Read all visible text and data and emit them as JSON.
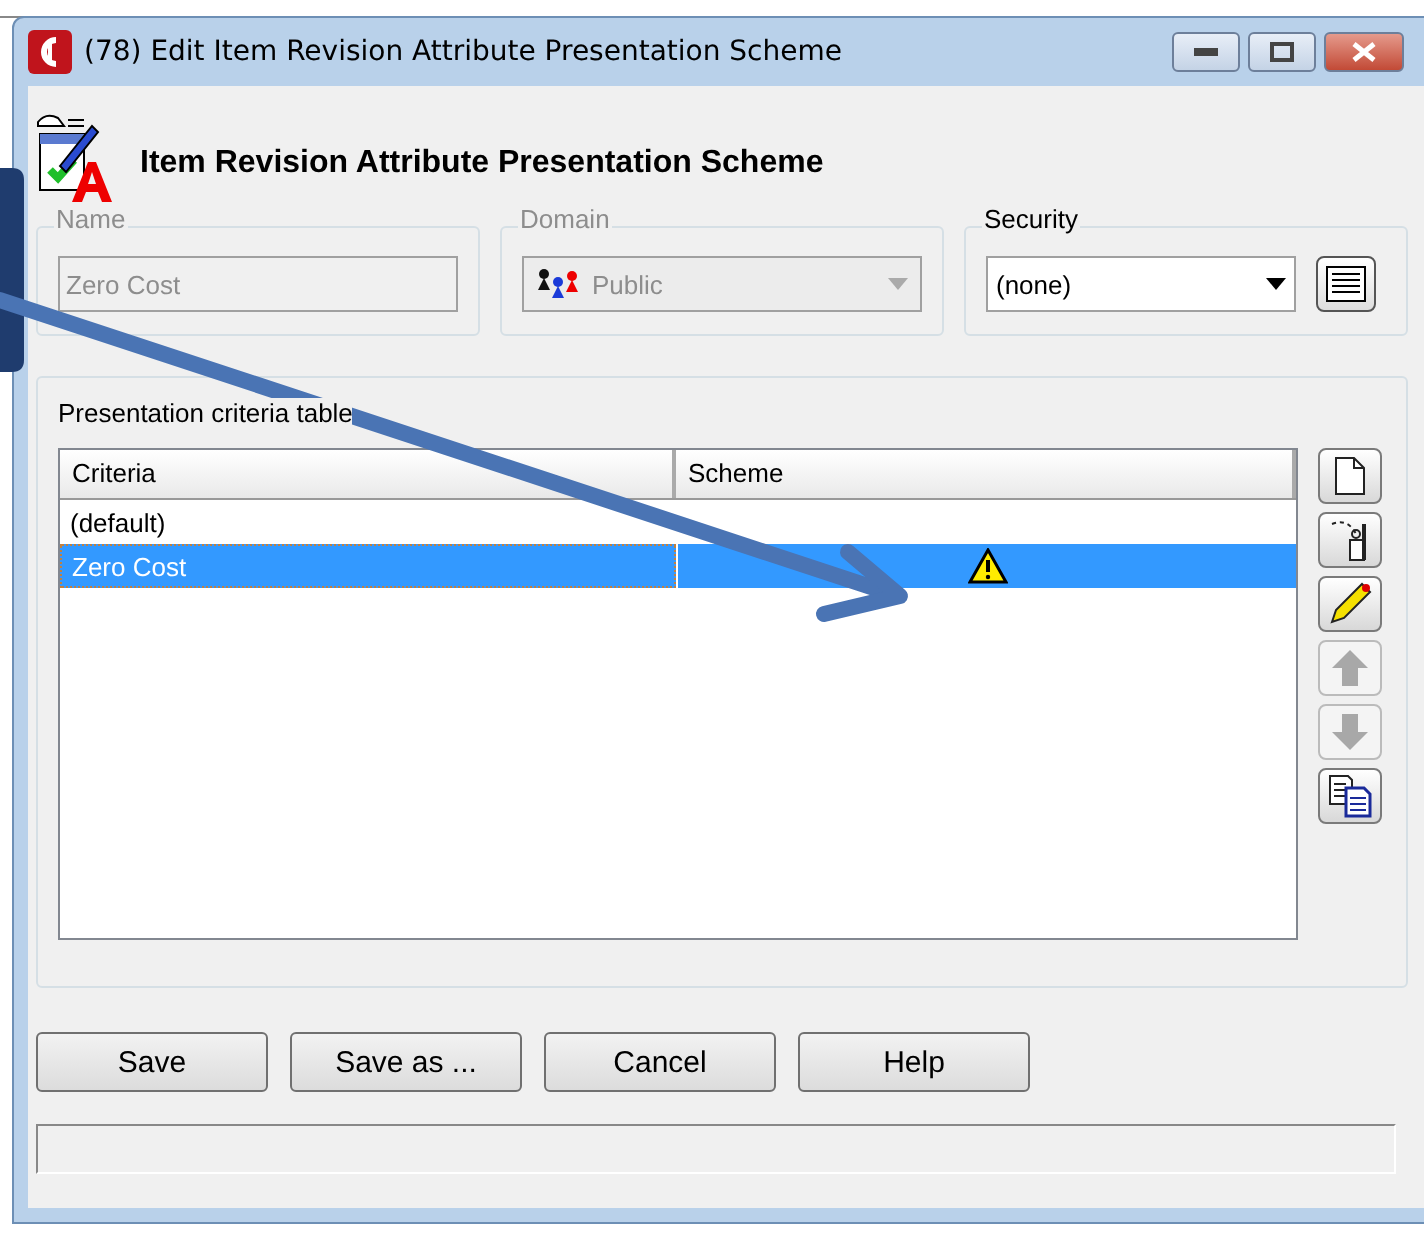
{
  "window": {
    "title": "(78) Edit Item Revision Attribute Presentation Scheme"
  },
  "header": {
    "title": "Item Revision Attribute Presentation Scheme"
  },
  "fields": [
    {
      "kind": "text",
      "label": "Name",
      "value": "Zero Cost",
      "disabled": true
    },
    {
      "kind": "domain",
      "label": "Domain",
      "value": "Public",
      "disabled": true
    },
    {
      "kind": "security",
      "label": "Security",
      "value": "(none)",
      "disabled": false
    }
  ],
  "table": {
    "label": "Presentation criteria table",
    "columns": [
      "Criteria",
      "Scheme"
    ],
    "rows": [
      {
        "criteria": "(default)",
        "warning": false,
        "selected": false
      },
      {
        "criteria": "Zero Cost",
        "warning": true,
        "selected": true
      }
    ]
  },
  "tools": [
    {
      "kind": "new",
      "disabled": false
    },
    {
      "kind": "import",
      "disabled": false
    },
    {
      "kind": "edit",
      "disabled": false
    },
    {
      "kind": "up",
      "disabled": true
    },
    {
      "kind": "down",
      "disabled": true
    },
    {
      "kind": "copy",
      "disabled": false
    }
  ],
  "buttons": [
    "Save",
    "Save as ...",
    "Cancel",
    "Help"
  ]
}
